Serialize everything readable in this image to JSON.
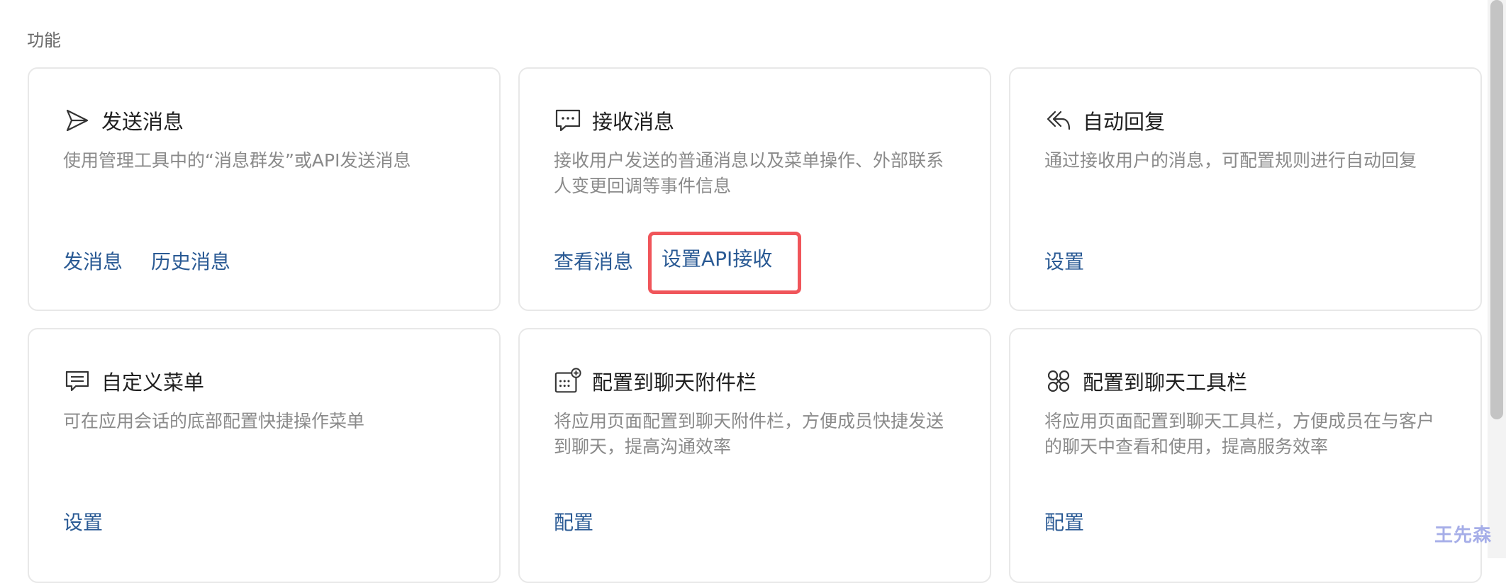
{
  "section": {
    "title": "功能"
  },
  "cards": [
    {
      "title": "发送消息",
      "icon": "send-icon",
      "desc": "使用管理工具中的“消息群发”或API发送消息",
      "actions": [
        "发消息",
        "历史消息"
      ]
    },
    {
      "title": "接收消息",
      "icon": "message-bubble-icon",
      "desc": "接收用户发送的普通消息以及菜单操作、外部联系人变更回调等事件信息",
      "actions": [
        "查看消息",
        "设置API接收"
      ]
    },
    {
      "title": "自动回复",
      "icon": "reply-icon",
      "desc": "通过接收用户的消息，可配置规则进行自动回复",
      "actions": [
        "设置"
      ]
    },
    {
      "title": "自定义菜单",
      "icon": "menu-icon",
      "desc": "可在应用会话的底部配置快捷操作菜单",
      "actions": [
        "设置"
      ]
    },
    {
      "title": "配置到聊天附件栏",
      "icon": "attachment-bar-icon",
      "desc": "将应用页面配置到聊天附件栏，方便成员快捷发送到聊天，提高沟通效率",
      "actions": [
        "配置"
      ]
    },
    {
      "title": "配置到聊天工具栏",
      "icon": "toolbar-icon",
      "desc": "将应用页面配置到聊天工具栏，方便成员在与客户的聊天中查看和使用，提高服务效率",
      "actions": [
        "配置"
      ]
    }
  ],
  "highlight_color": "#f0555a",
  "link_color": "#2a5a94",
  "watermark": "王先森"
}
